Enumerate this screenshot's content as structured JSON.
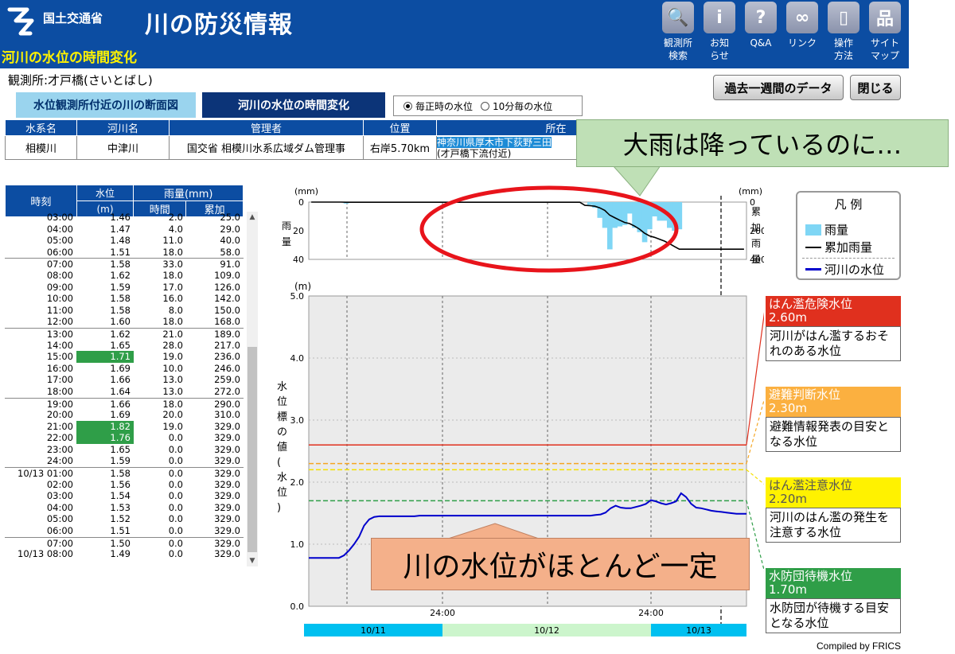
{
  "header": {
    "ministry": "国土交通省",
    "site_title": "川の防災情報",
    "page_title": "河川の水位の時間変化",
    "nav": [
      {
        "icon": "magnifier-icon",
        "label": "観測所\n検索"
      },
      {
        "icon": "info-icon",
        "label": "お知\nらせ"
      },
      {
        "icon": "question-icon",
        "label": "Q&A"
      },
      {
        "icon": "link-icon",
        "label": "リンク"
      },
      {
        "icon": "mouse-icon",
        "label": "操作\n方法"
      },
      {
        "icon": "sitemap-icon",
        "label": "サイト\nマップ"
      }
    ]
  },
  "station": "観測所:才戸橋(さいとばし)",
  "buttons": {
    "past_week": "過去一週間のデータ",
    "close": "閉じる"
  },
  "tabs": {
    "cross_section": "水位観測所付近の川の断面図",
    "time_change": "河川の水位の時間変化"
  },
  "radio": {
    "hourly": "毎正時の水位",
    "ten_min": "10分毎の水位"
  },
  "info_table": {
    "headers": [
      "水系名",
      "河川名",
      "管理者",
      "位置",
      "所在"
    ],
    "values": [
      "相模川",
      "中津川",
      "国交省 相模川水系広域ダム管理事",
      "右岸5.70km"
    ],
    "location_1": "神奈川県厚木市下荻野三田",
    "location_2": "(才戸橋下流付近)"
  },
  "hourly": {
    "headers": {
      "time": "時刻",
      "level": "水位",
      "level_unit": "(m)",
      "rain": "雨量(mm)",
      "rain_hour": "時間",
      "rain_cum": "累加"
    },
    "rows": [
      {
        "t": "03:00",
        "l": "1.46",
        "h": "2.0",
        "c": "25.0"
      },
      {
        "t": "04:00",
        "l": "1.47",
        "h": "4.0",
        "c": "29.0"
      },
      {
        "t": "05:00",
        "l": "1.48",
        "h": "11.0",
        "c": "40.0"
      },
      {
        "t": "06:00",
        "l": "1.51",
        "h": "18.0",
        "c": "58.0"
      },
      {
        "t": "07:00",
        "l": "1.58",
        "h": "33.0",
        "c": "91.0",
        "sep": true
      },
      {
        "t": "08:00",
        "l": "1.62",
        "h": "18.0",
        "c": "109.0"
      },
      {
        "t": "09:00",
        "l": "1.59",
        "h": "17.0",
        "c": "126.0"
      },
      {
        "t": "10:00",
        "l": "1.58",
        "h": "16.0",
        "c": "142.0"
      },
      {
        "t": "11:00",
        "l": "1.58",
        "h": "8.0",
        "c": "150.0"
      },
      {
        "t": "12:00",
        "l": "1.60",
        "h": "18.0",
        "c": "168.0"
      },
      {
        "t": "13:00",
        "l": "1.62",
        "h": "21.0",
        "c": "189.0",
        "sep": true
      },
      {
        "t": "14:00",
        "l": "1.65",
        "h": "28.0",
        "c": "217.0"
      },
      {
        "t": "15:00",
        "l": "1.71",
        "h": "19.0",
        "c": "236.0",
        "high": true
      },
      {
        "t": "16:00",
        "l": "1.69",
        "h": "10.0",
        "c": "246.0"
      },
      {
        "t": "17:00",
        "l": "1.66",
        "h": "13.0",
        "c": "259.0"
      },
      {
        "t": "18:00",
        "l": "1.64",
        "h": "13.0",
        "c": "272.0"
      },
      {
        "t": "19:00",
        "l": "1.66",
        "h": "18.0",
        "c": "290.0",
        "sep": true
      },
      {
        "t": "20:00",
        "l": "1.69",
        "h": "20.0",
        "c": "310.0"
      },
      {
        "t": "21:00",
        "l": "1.82",
        "h": "19.0",
        "c": "329.0",
        "high": true
      },
      {
        "t": "22:00",
        "l": "1.76",
        "h": "0.0",
        "c": "329.0",
        "high": true
      },
      {
        "t": "23:00",
        "l": "1.65",
        "h": "0.0",
        "c": "329.0"
      },
      {
        "t": "24:00",
        "l": "1.59",
        "h": "0.0",
        "c": "329.0"
      },
      {
        "t": "10/13 01:00",
        "l": "1.58",
        "h": "0.0",
        "c": "329.0",
        "sep": true
      },
      {
        "t": "02:00",
        "l": "1.56",
        "h": "0.0",
        "c": "329.0"
      },
      {
        "t": "03:00",
        "l": "1.54",
        "h": "0.0",
        "c": "329.0"
      },
      {
        "t": "04:00",
        "l": "1.53",
        "h": "0.0",
        "c": "329.0"
      },
      {
        "t": "05:00",
        "l": "1.52",
        "h": "0.0",
        "c": "329.0"
      },
      {
        "t": "06:00",
        "l": "1.51",
        "h": "0.0",
        "c": "329.0"
      },
      {
        "t": "07:00",
        "l": "1.50",
        "h": "0.0",
        "c": "329.0",
        "sep": true
      },
      {
        "t": "10/13 08:00",
        "l": "1.49",
        "h": "0.0",
        "c": "329.0"
      }
    ]
  },
  "chart_data": {
    "type": "line",
    "rain_panel": {
      "unit_left": "(mm)",
      "unit_right": "(mm)",
      "ylabel_left": "雨量",
      "ylabel_right": "累加雨量",
      "yticks_left": [
        "0",
        "20",
        "40"
      ],
      "yticks_right": [
        "0",
        "200",
        "400"
      ],
      "ylim_left": [
        0,
        40
      ],
      "ylim_right": [
        0,
        400
      ],
      "hourly_rain": [
        0,
        0,
        0,
        0,
        0,
        0,
        0,
        1,
        0,
        0,
        0,
        0,
        0,
        0,
        0,
        0,
        0,
        0,
        0,
        0,
        0,
        0,
        0,
        0,
        0,
        0,
        0,
        0,
        0,
        0,
        0,
        0,
        0,
        0,
        0,
        0,
        0,
        0,
        0,
        0,
        0,
        0,
        0,
        0,
        0,
        0,
        0,
        0,
        0,
        0,
        0,
        0,
        0,
        0,
        0,
        0,
        2,
        4,
        11,
        18,
        33,
        18,
        17,
        16,
        8,
        18,
        21,
        28,
        19,
        10,
        13,
        13,
        18,
        20,
        19,
        0,
        0,
        0,
        0,
        0,
        0,
        0,
        0,
        0,
        0,
        0,
        0,
        0
      ],
      "cumulative_rain": [
        0,
        0,
        0,
        0,
        0,
        0,
        0,
        1,
        1,
        1,
        1,
        1,
        1,
        1,
        1,
        1,
        1,
        1,
        1,
        1,
        1,
        1,
        1,
        1,
        1,
        1,
        1,
        1,
        1,
        1,
        1,
        1,
        1,
        1,
        1,
        1,
        1,
        1,
        1,
        1,
        1,
        1,
        1,
        1,
        1,
        1,
        1,
        1,
        1,
        1,
        1,
        1,
        1,
        1,
        1,
        23,
        25,
        29,
        40,
        58,
        91,
        109,
        126,
        142,
        150,
        168,
        189,
        217,
        236,
        246,
        259,
        272,
        290,
        310,
        329,
        329,
        329,
        329,
        329,
        329,
        329,
        329,
        329,
        329,
        329,
        329,
        329,
        329
      ]
    },
    "level_panel": {
      "unit": "(m)",
      "ylabel": "水位標の値(水位)",
      "yticks": [
        "0.0",
        "1.0",
        "2.0",
        "3.0",
        "4.0",
        "5.0"
      ],
      "ylim": [
        0,
        5
      ],
      "series_values": [
        0.78,
        0.78,
        0.78,
        0.78,
        0.78,
        0.78,
        0.78,
        0.82,
        0.9,
        1.0,
        1.12,
        1.3,
        1.4,
        1.44,
        1.45,
        1.45,
        1.45,
        1.45,
        1.45,
        1.45,
        1.45,
        1.45,
        1.46,
        1.46,
        1.46,
        1.46,
        1.46,
        1.46,
        1.46,
        1.46,
        1.46,
        1.46,
        1.46,
        1.46,
        1.46,
        1.46,
        1.46,
        1.46,
        1.46,
        1.46,
        1.46,
        1.46,
        1.46,
        1.46,
        1.46,
        1.46,
        1.46,
        1.46,
        1.46,
        1.46,
        1.46,
        1.46,
        1.46,
        1.46,
        1.46,
        1.46,
        1.46,
        1.47,
        1.48,
        1.51,
        1.58,
        1.62,
        1.59,
        1.58,
        1.58,
        1.6,
        1.62,
        1.65,
        1.71,
        1.69,
        1.66,
        1.64,
        1.66,
        1.69,
        1.82,
        1.76,
        1.65,
        1.59,
        1.58,
        1.56,
        1.54,
        1.53,
        1.52,
        1.51,
        1.5,
        1.49,
        1.49,
        1.49
      ],
      "levels": [
        {
          "value": 2.6,
          "color": "#e0301e"
        },
        {
          "value": 2.3,
          "color": "#f5a623"
        },
        {
          "value": 2.2,
          "color": "#f5e000"
        },
        {
          "value": 1.7,
          "color": "#2f9e48"
        }
      ],
      "xtick_labels": [
        "24:00",
        "24:00"
      ],
      "date_bands": [
        {
          "label": "10/11",
          "color": "#00c0f0"
        },
        {
          "label": "10/12",
          "color": "#ccf5cc"
        },
        {
          "label": "10/13",
          "color": "#00c0f0"
        }
      ]
    }
  },
  "legend": {
    "title": "凡 例",
    "rain": "雨量",
    "cumulative": "累加雨量",
    "level": "河川の水位",
    "rain_color": "#7fd6f5",
    "cumulative_color": "#000000",
    "level_color": "#0000cc"
  },
  "level_boxes": [
    {
      "name": "はん濫危険水位",
      "value": "2.60m",
      "desc": "河川がはん濫するおそれのある水位",
      "bg": "#e0301e",
      "fg": "#ffffff"
    },
    {
      "name": "避難判断水位",
      "value": "2.30m",
      "desc": "避難情報発表の目安となる水位",
      "bg": "#fbb040",
      "fg": "#ffffff"
    },
    {
      "name": "はん濫注意水位",
      "value": "2.20m",
      "desc": "河川のはん濫の発生を注意する水位",
      "bg": "#fff200",
      "fg": "#555555"
    },
    {
      "name": "水防団待機水位",
      "value": "1.70m",
      "desc": "水防団が待機する目安となる水位",
      "bg": "#2f9e48",
      "fg": "#ffffff"
    }
  ],
  "callouts": {
    "heavy_rain": "大雨は降っているのに…",
    "level_constant": "川の水位がほとんど一定"
  },
  "credit": "Compiled by FRICS"
}
